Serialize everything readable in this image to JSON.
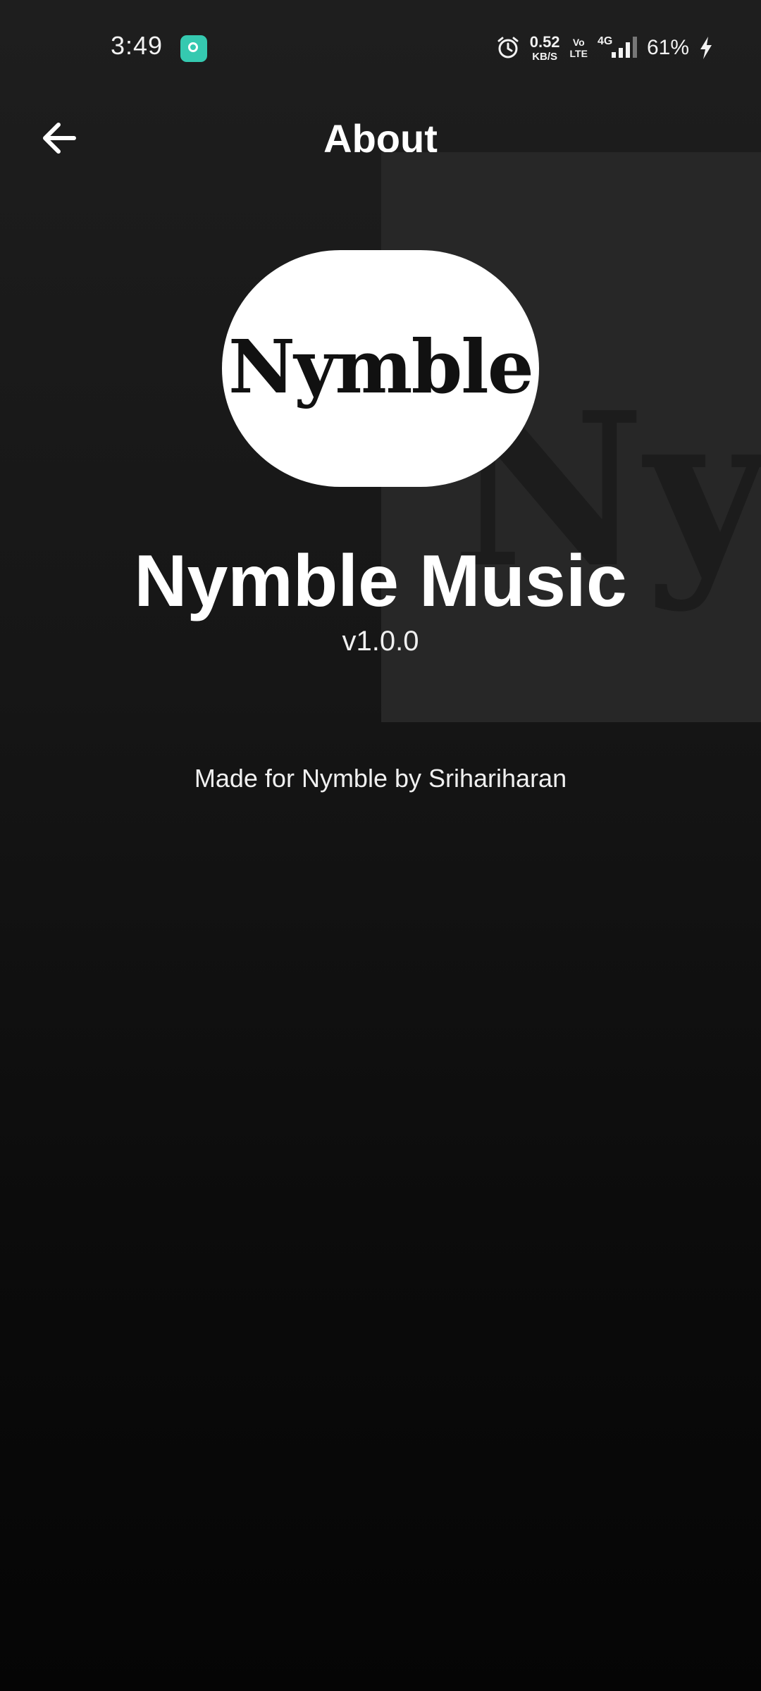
{
  "status_bar": {
    "time": "3:49",
    "app_icon": "chat-bubble-icon",
    "alarm_icon": "alarm-clock-icon",
    "net_speed_value": "0.52",
    "net_speed_unit": "KB/S",
    "volte_top": "Vo",
    "volte_bottom": "LTE",
    "network_type": "4G",
    "battery_percent": "61%",
    "charging_icon": "lightning-bolt-icon",
    "accent_color": "#35c9b0"
  },
  "header": {
    "back_icon": "arrow-left-icon",
    "title": "About"
  },
  "background_art": {
    "text": "Nym"
  },
  "app": {
    "logo_text": "Nymble",
    "name": "Nymble Music",
    "version": "v1.0.0",
    "credits": "Made for Nymble by Srihariharan"
  }
}
